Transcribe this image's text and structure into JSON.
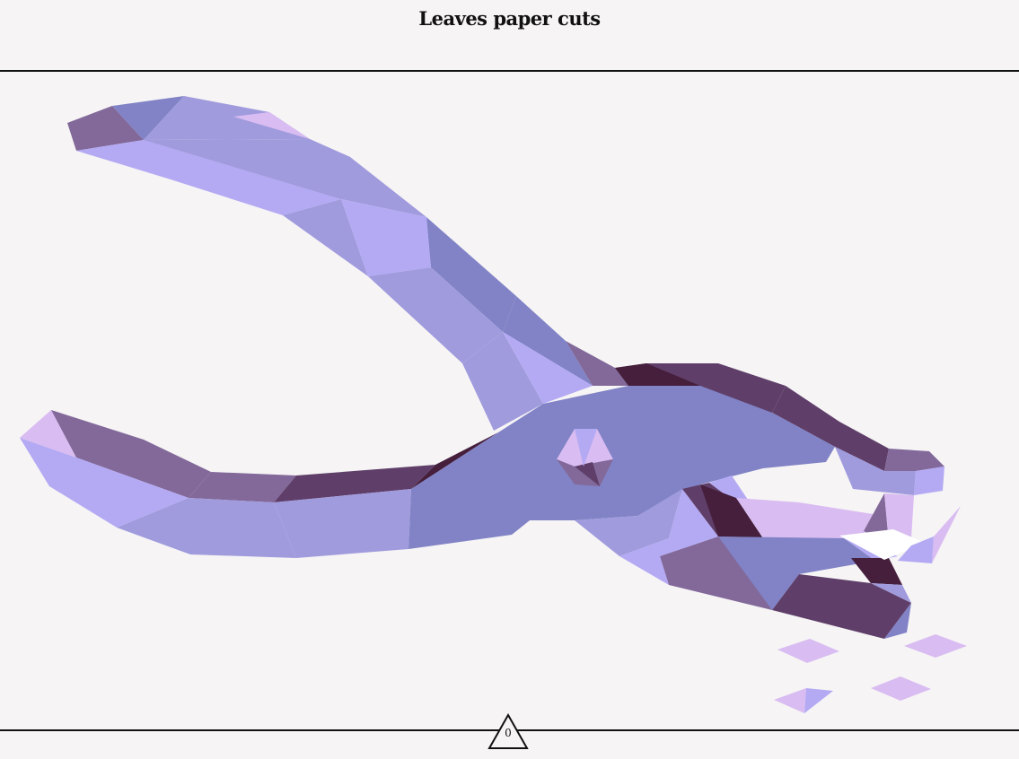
{
  "header": {
    "title": "Leaves paper cuts"
  },
  "illustration": {
    "icon": "hole-punch-pliers-icon",
    "palette": {
      "light": "#b4aaf4",
      "mid": "#a09bdd",
      "blue": "#8183c6",
      "mauve": "#82699a",
      "dark": "#5f3f69",
      "darkest": "#451f3c",
      "pink": "#d9bcf1",
      "background": "#f6f4f5"
    }
  },
  "confetti": {
    "icon": "paper-chip-icon",
    "count": 4
  },
  "counter": {
    "icon": "triangle-icon",
    "value": "0"
  }
}
